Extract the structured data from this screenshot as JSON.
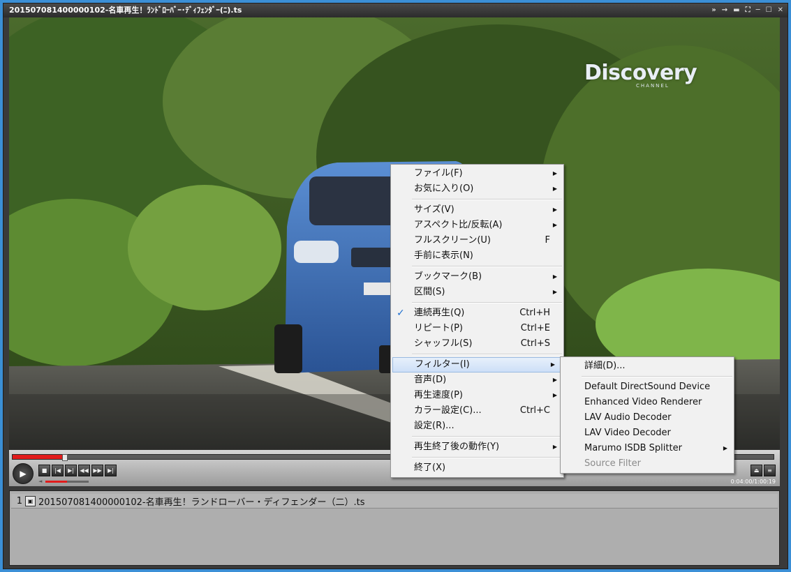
{
  "window": {
    "title": "201507081400000102-名車再生！ﾗﾝﾄﾞﾛｰﾊﾞｰ･ﾃﾞｨﾌｪﾝﾀﾞｰ(ﾆ).ts",
    "controls": [
      "»",
      "→",
      "▬",
      "⛶",
      "─",
      "☐",
      "✕"
    ]
  },
  "video": {
    "logo": "Discovery",
    "logo_sub": "CHANNEL"
  },
  "player": {
    "seek_progress": 0.065,
    "volume": 0.5,
    "time": "0:04:00/1:00:19",
    "buttons": [
      "■",
      "|◀",
      "▶|",
      "◀◀",
      "▶▶",
      "▶|"
    ]
  },
  "playlist": {
    "items": [
      {
        "num": "1",
        "name": "201507081400000102-名車再生！ランドローバー・ディフェンダー（二）.ts"
      }
    ]
  },
  "menu": {
    "items": [
      {
        "label": "ファイル(F)",
        "arrow": true
      },
      {
        "label": "お気に入り(O)",
        "arrow": true
      },
      {
        "sep": true
      },
      {
        "label": "サイズ(V)",
        "arrow": true
      },
      {
        "label": "アスペクト比/反転(A)",
        "arrow": true
      },
      {
        "label": "フルスクリーン(U)",
        "shortcut": "F"
      },
      {
        "label": "手前に表示(N)"
      },
      {
        "sep": true
      },
      {
        "label": "ブックマーク(B)",
        "arrow": true
      },
      {
        "label": "区間(S)",
        "arrow": true
      },
      {
        "sep": true
      },
      {
        "label": "連続再生(Q)",
        "shortcut": "Ctrl+H",
        "checked": true
      },
      {
        "label": "リピート(P)",
        "shortcut": "Ctrl+E"
      },
      {
        "label": "シャッフル(S)",
        "shortcut": "Ctrl+S"
      },
      {
        "sep": true
      },
      {
        "label": "フィルター(I)",
        "arrow": true,
        "highlighted": true
      },
      {
        "label": "音声(D)",
        "arrow": true
      },
      {
        "label": "再生速度(P)",
        "arrow": true
      },
      {
        "label": "カラー設定(C)...",
        "shortcut": "Ctrl+C"
      },
      {
        "label": "設定(R)..."
      },
      {
        "sep": true
      },
      {
        "label": "再生終了後の動作(Y)",
        "arrow": true
      },
      {
        "sep": true
      },
      {
        "label": "終了(X)"
      }
    ]
  },
  "submenu": {
    "items": [
      {
        "label": "詳細(D)..."
      },
      {
        "sep": true
      },
      {
        "label": "Default DirectSound Device"
      },
      {
        "label": "Enhanced Video Renderer"
      },
      {
        "label": "LAV Audio Decoder"
      },
      {
        "label": "LAV Video Decoder"
      },
      {
        "label": "Marumo ISDB Splitter",
        "arrow": true
      },
      {
        "label": "Source Filter",
        "disabled": true
      }
    ]
  },
  "icons": {
    "check": "✓",
    "arrow": "▶",
    "play": "▶",
    "eject": "⏏",
    "list": "≡"
  }
}
